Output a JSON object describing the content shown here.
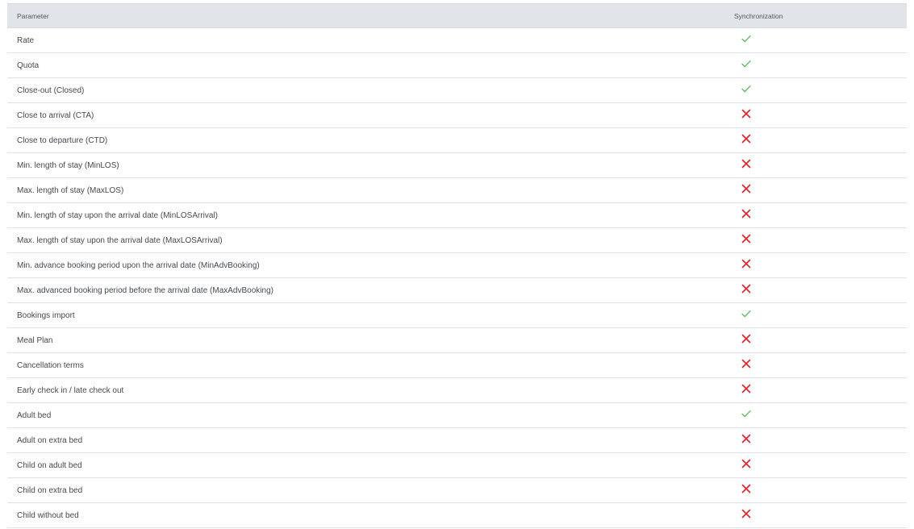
{
  "table": {
    "header": {
      "parameter": "Parameter",
      "synchronization": "Synchronization"
    },
    "rows": [
      {
        "label": "Rate",
        "sync": true
      },
      {
        "label": "Quota",
        "sync": true
      },
      {
        "label": "Close-out (Closed)",
        "sync": true
      },
      {
        "label": "Close to arrival (CTA)",
        "sync": false
      },
      {
        "label": "Close to departure (CTD)",
        "sync": false
      },
      {
        "label": "Min. length of stay (MinLOS)",
        "sync": false
      },
      {
        "label": "Max. length of stay (MaxLOS)",
        "sync": false
      },
      {
        "label": "Min. length of stay upon the arrival date (MinLOSArrival)",
        "sync": false
      },
      {
        "label": "Max. length of stay upon the arrival date (MaxLOSArrival)",
        "sync": false
      },
      {
        "label": "Min. advance booking period upon the arrival date (MinAdvBooking)",
        "sync": false
      },
      {
        "label": "Max. advanced booking period before the arrival date (MaxAdvBooking)",
        "sync": false
      },
      {
        "label": "Bookings import",
        "sync": true
      },
      {
        "label": "Meal Plan",
        "sync": false
      },
      {
        "label": "Cancellation terms",
        "sync": false
      },
      {
        "label": "Early check in / late check out",
        "sync": false
      },
      {
        "label": "Adult bed",
        "sync": true
      },
      {
        "label": "Adult on extra bed",
        "sync": false
      },
      {
        "label": "Child on adult bed",
        "sync": false
      },
      {
        "label": "Child on extra bed",
        "sync": false
      },
      {
        "label": "Child without bed",
        "sync": false
      }
    ]
  },
  "icons": {
    "synced": "check-icon",
    "not_synced": "cross-icon"
  },
  "colors": {
    "check": "#5cb85c",
    "cross": "#e0242b",
    "header_bg": "#e1e4e8"
  }
}
